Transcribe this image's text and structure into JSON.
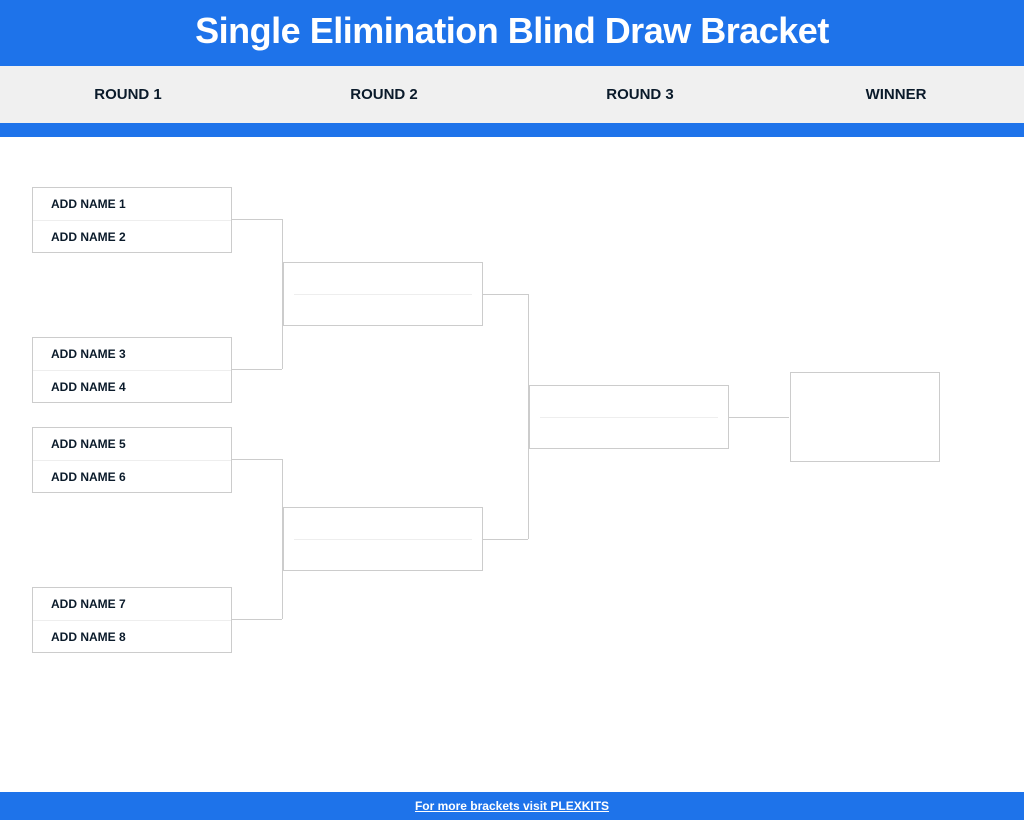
{
  "header": {
    "title": "Single Elimination Blind Draw Bracket"
  },
  "rounds": {
    "r1": "ROUND 1",
    "r2": "ROUND 2",
    "r3": "ROUND 3",
    "winner": "WINNER"
  },
  "slots": {
    "p1": "ADD NAME 1",
    "p2": "ADD NAME 2",
    "p3": "ADD NAME 3",
    "p4": "ADD NAME 4",
    "p5": "ADD NAME 5",
    "p6": "ADD NAME 6",
    "p7": "ADD NAME 7",
    "p8": "ADD NAME 8"
  },
  "footer": {
    "link_text": "For more brackets visit PLEXKITS"
  }
}
